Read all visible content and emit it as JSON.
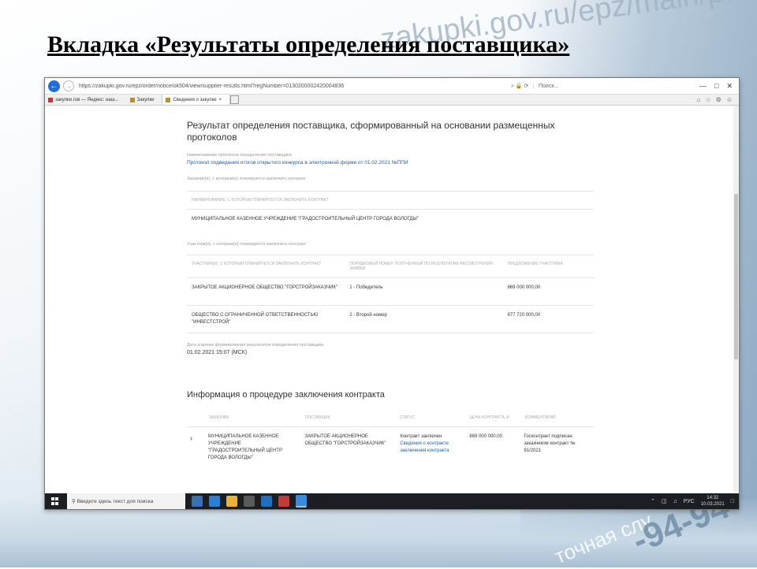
{
  "slide": {
    "title": "Вкладка «Результаты определения поставщика»",
    "bg_url": "zakupki.gov.ru/epz/main/public/home.html",
    "bg_phone": "-94-94",
    "bg_service": "точная слу"
  },
  "browser": {
    "back_icon": "arrow-left-icon",
    "url": "https://zakupki.gov.ru/epz/order/notice/ok504/view/supplier-results.html?regNumber=0130200002420004836",
    "url_tools": "⌕ 🔒 ⟳",
    "search_placeholder": "Поиск...",
    "tabs": [
      {
        "label": "закупки.гов — Яндекс: наш...",
        "active": false
      },
      {
        "label": "Закупки",
        "active": false
      },
      {
        "label": "Сведения о закупке",
        "active": true
      }
    ]
  },
  "page": {
    "heading": "Результат определения поставщика, сформированный на основании размещенных протоколов",
    "protocol_label": "Наименование протокола определения поставщика",
    "protocol_link": "Протокол подведения итогов открытого конкурса в электронной форме от 01.02.2021 №ППИ",
    "customers_label": "Заказчик(и), с которым(и) планируется заключить контракт",
    "customers_head": "Наименование, с которым планируется заключить контракт",
    "customer_name": "МУНИЦИПАЛЬНОЕ КАЗЕННОЕ УЧРЕЖДЕНИЕ \"ГРАДОСТРОИТЕЛЬНЫЙ ЦЕНТР ГОРОДА ВОЛОГДЫ\"",
    "participants_label": "Участник(и), с которым(и) планируется заключить контракт",
    "participants_headers": [
      "Участник(и), с которым планируется заключить контракт",
      "Порядковый номер, полученный по результатам рассмотрения заявки",
      "Предложение участника"
    ],
    "participants": [
      {
        "name": "ЗАКРЫТОЕ АКЦИОНЕРНОЕ ОБЩЕСТВО \"ГОРСТРОЙЗАКАЗЧИК\"",
        "rank": "1 - Победитель",
        "offer": "869 000 000,00"
      },
      {
        "name": "ОБЩЕСТВО С ОГРАНИЧЕННОЙ ОТВЕТСТВЕННОСТЬЮ \"ИНВЕСТСТРОЙ\"",
        "rank": "2 - Второй номер",
        "offer": "877 720 000,00"
      }
    ],
    "date_label": "Дата и время формирования результатов определения поставщика",
    "date_value": "01.02.2021 15:07 (МСК)",
    "contract_heading": "Информация о процедуре заключения контракта",
    "contract_headers": [
      "Заказчик",
      "Поставщик",
      "Статус",
      "Цена контракта, ₽",
      "Комментарий"
    ],
    "contract_row": {
      "customer": "МУНИЦИПАЛЬНОЕ КАЗЕННОЕ УЧРЕЖДЕНИЕ \"ГРАДОСТРОИТЕЛЬНЫЙ ЦЕНТР ГОРОДА ВОЛОГДЫ\"",
      "supplier": "ЗАКРЫТОЕ АКЦИОНЕРНОЕ ОБЩЕСТВО \"ГОРСТРОЙЗАКАЗЧИК\"",
      "status": "Контракт заключен",
      "status_link": "Сведения о контракте заключения контракта",
      "price": "869 000 000,00",
      "comment": "Госконтракт подписан заказчиком контракт № 91/2021"
    }
  },
  "taskbar": {
    "search_placeholder": "Введите здесь текст для поиска",
    "lang": "РУС",
    "time": "14:32",
    "date": "10.03.2021"
  }
}
